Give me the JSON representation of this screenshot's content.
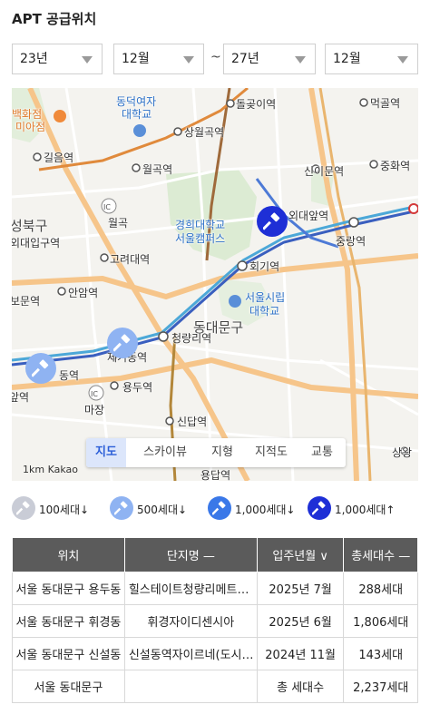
{
  "title": "APT 공급위치",
  "filters": {
    "start_year": "23년",
    "start_month": "12월",
    "separator": "~",
    "end_year": "27년",
    "end_month": "12월"
  },
  "map": {
    "labels": {
      "dongduk": "동덕여자",
      "dongduk2": "대학교",
      "dolgoji": "돌곶이역",
      "meokgol": "먹골역",
      "mia": "미아점",
      "mia_store": "백화점",
      "sangwolgok": "상월곡역",
      "gileum": "길음역",
      "sini": "신이문역",
      "junghwa": "중화역",
      "wolgok_st": "월곡역",
      "wolgok": "월곡",
      "khu1": "경희대학교",
      "khu2": "서울캠퍼스",
      "oedae": "외대앞역",
      "seongbuk": "성북구",
      "hufs": "외대입구역",
      "jungnang": "중랑역",
      "korea_univ": "고려대역",
      "hoegi": "회기역",
      "anam": "안암역",
      "bomun": "보문역",
      "uos1": "서울시립",
      "uos2": "대학교",
      "dongdaemun_gu": "동대문구",
      "cheongnyangni": "청량리역",
      "jegi": "제기동역",
      "sinseol": "동역",
      "ap": "앞역",
      "yongdu": "용두역",
      "mangu": "마장",
      "sindap": "신답역",
      "sangwang": "상왕",
      "yongdap": "용답역",
      "scale": "1km Kakao"
    },
    "tabs": [
      "지도",
      "스카이뷰",
      "지형",
      "지적도",
      "교통"
    ],
    "active_tab": "지도",
    "pin_colors": {
      "p100": "#c9ccd6",
      "p500": "#8fb3f2",
      "p1000": "#3a78e8",
      "p1000up": "#1e2fd6"
    }
  },
  "legend": [
    {
      "label": "100세대↓",
      "icon": "hammer-icon",
      "color": "#c9ccd6"
    },
    {
      "label": "500세대↓",
      "icon": "hammer-icon",
      "color": "#8fb3f2"
    },
    {
      "label": "1,000세대↓",
      "icon": "hammer-icon",
      "color": "#3a78e8"
    },
    {
      "label": "1,000세대↑",
      "icon": "hammer-icon",
      "color": "#1e2fd6"
    }
  ],
  "table": {
    "headers": [
      "위치",
      "단지명 —",
      "입주년월 ∨",
      "총세대수 —"
    ],
    "rows": [
      {
        "location": "서울 동대문구 용두동",
        "complex": "힐스테이트청량리메트로블",
        "date": "2025년 7월",
        "units": "288세대"
      },
      {
        "location": "서울 동대문구 휘경동",
        "complex": "휘경자이디센시아",
        "date": "2025년 6월",
        "units": "1,806세대"
      },
      {
        "location": "서울 동대문구 신설동",
        "complex": "신설동역자이르네(도시형)",
        "date": "2024년 11월",
        "units": "143세대"
      }
    ],
    "total": {
      "location": "서울 동대문구",
      "complex": "",
      "label": "총 세대수",
      "units": "2,237세대"
    }
  }
}
